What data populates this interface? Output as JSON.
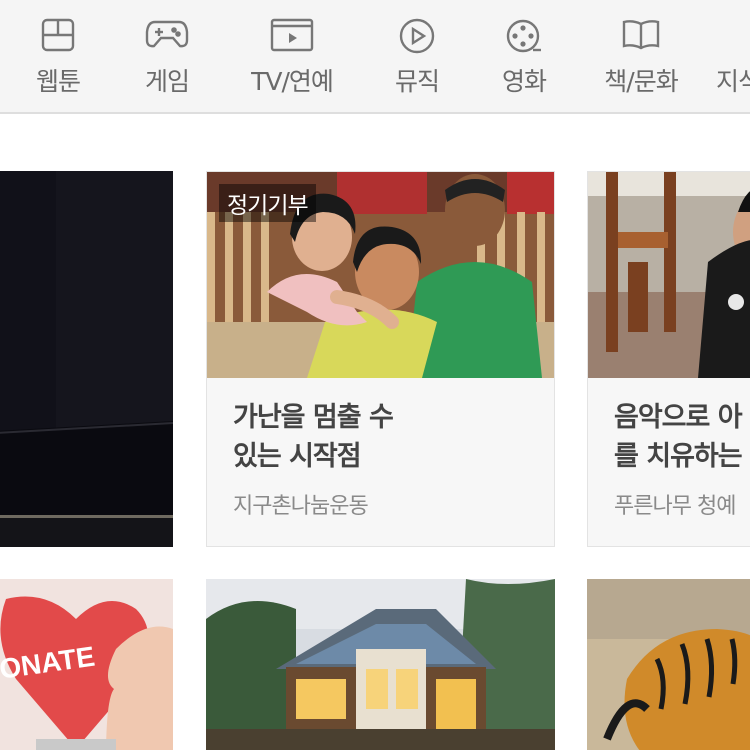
{
  "nav": {
    "items": [
      {
        "label": "웹툰",
        "icon": "webtoon-icon"
      },
      {
        "label": "게임",
        "icon": "gamepad-icon"
      },
      {
        "label": "TV/연예",
        "icon": "tv-icon"
      },
      {
        "label": "뮤직",
        "icon": "play-circle-icon"
      },
      {
        "label": "영화",
        "icon": "film-reel-icon"
      },
      {
        "label": "책/문화",
        "icon": "book-icon"
      },
      {
        "label": "지식",
        "icon": ""
      }
    ]
  },
  "cards": {
    "mid1": {
      "badge": "정기기부",
      "title_line1": "가난을 멈출 수",
      "title_line2": "있는 시작점",
      "org": "지구촌나눔운동"
    },
    "right1": {
      "title_line1": "음악으로 아",
      "title_line2": "를 치유하는",
      "org": "푸른나무 청예"
    },
    "left2": {
      "sign_text": "ONATE"
    }
  },
  "colors": {
    "nav_bg": "#f5f5f5",
    "nav_text": "#6a6a6a",
    "card_bg": "#f7f7f7",
    "title_text": "#444444",
    "org_text": "#8a8a8a"
  }
}
